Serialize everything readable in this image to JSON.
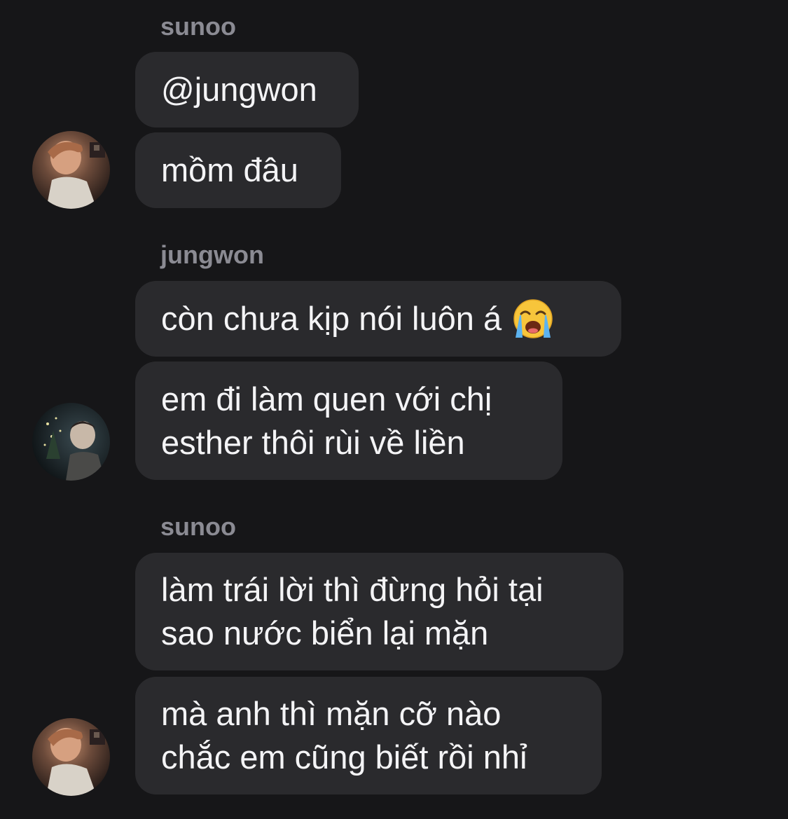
{
  "conversation": [
    {
      "sender": "sunoo",
      "messages": [
        "@jungwon",
        "mồm đâu"
      ]
    },
    {
      "sender": "jungwon",
      "messages": [
        "còn chưa kịp nói luôn á",
        "em đi làm quen với chị\nesther thôi rùi về liền"
      ],
      "emoji": "loudly-crying-face-icon"
    },
    {
      "sender": "sunoo",
      "messages": [
        "làm trái lời thì đừng hỏi tại\nsao nước biển lại mặn",
        "mà anh thì mặn cỡ nào\nchắc em cũng biết rồi nhỉ"
      ]
    }
  ],
  "colors": {
    "background": "#161618",
    "bubble": "#2a2a2d",
    "sender_name": "#8b8b93",
    "message_text": "#f4f4f6"
  }
}
